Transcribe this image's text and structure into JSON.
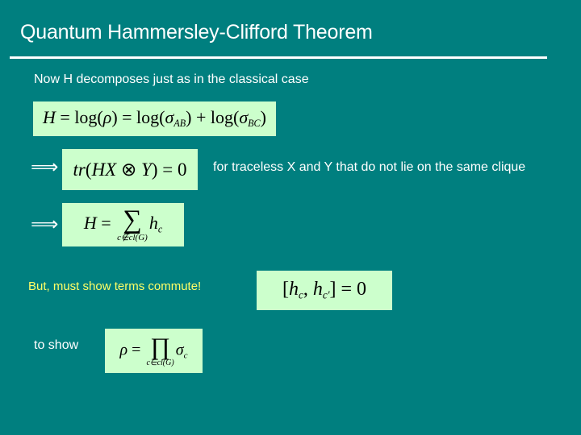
{
  "slide": {
    "title": "Quantum Hammersley-Clifford Theorem",
    "intro": "Now H decomposes just as in the classical case",
    "equations": {
      "eq1": "H = log(ρ) = log(σAB) + log(σBC)",
      "eq2": "tr(HX ⊗ Y) = 0",
      "eq3": "H = Σ_{c∉cl(G)} h_c",
      "eq4": "[h_c, h_c'] = 0",
      "eq5": "ρ = Π_{c∈cl(G)} σ_c"
    },
    "implies_symbol": "⟹",
    "condition_text": "for traceless X and Y that do not lie on the same clique",
    "highlight_text": "But, must show terms commute!",
    "to_show_text": "to show",
    "colors": {
      "background": "#007f7f",
      "equation_box": "#ccffcc",
      "highlight": "#ffff66",
      "text": "#ffffff"
    }
  }
}
